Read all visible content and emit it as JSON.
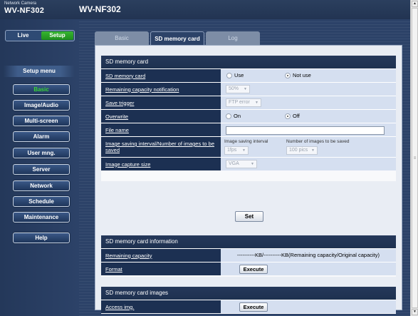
{
  "header": {
    "brand_small": "Network Camera",
    "brand_model": "WV-NF302",
    "title": "WV-NF302"
  },
  "mode": {
    "live": "Live",
    "setup": "Setup"
  },
  "sidebar": {
    "heading": "Setup menu",
    "items": [
      {
        "label": "Basic",
        "active": true
      },
      {
        "label": "Image/Audio"
      },
      {
        "label": "Multi-screen"
      },
      {
        "label": "Alarm"
      },
      {
        "label": "User mng."
      },
      {
        "label": "Server"
      },
      {
        "label": "Network"
      },
      {
        "label": "Schedule"
      },
      {
        "label": "Maintenance"
      },
      {
        "label": "Help"
      }
    ]
  },
  "tabs": [
    {
      "label": "Basic"
    },
    {
      "label": "SD memory card",
      "active": true
    },
    {
      "label": "Log"
    }
  ],
  "sd_settings": {
    "heading": "SD memory card",
    "sd_card": {
      "label": "SD memory card",
      "use": "Use",
      "not_use": "Not use",
      "selected": "Not use"
    },
    "notification": {
      "label": "Remaining capacity notification",
      "value": "50%"
    },
    "save_trigger": {
      "label": "Save trigger",
      "value": "FTP error"
    },
    "overwrite": {
      "label": "Overwrite",
      "on": "On",
      "off": "Off",
      "selected": "Off"
    },
    "file_name": {
      "label": "File name",
      "value": ""
    },
    "interval": {
      "label": "Image saving interval/Number of images to be saved",
      "interval_label": "Image saving interval",
      "interval_value": "1fps",
      "count_label": "Number of images to be saved",
      "count_value": "100 pics"
    },
    "capture_size": {
      "label": "Image capture size",
      "value": "VGA"
    },
    "set_button": "Set"
  },
  "sd_info": {
    "heading": "SD memory card information",
    "remaining": {
      "label": "Remaining capacity",
      "value": "----------KB/----------KB(Remaining capacity/Original capacity)"
    },
    "format": {
      "label": "Format",
      "button": "Execute"
    }
  },
  "sd_images": {
    "heading": "SD memory card images",
    "access": {
      "label": "Access img.",
      "button": "Execute"
    }
  },
  "colors": {
    "accent_green": "#2fa52b",
    "navy": "#1c3052",
    "panel": "#e9edf4"
  }
}
